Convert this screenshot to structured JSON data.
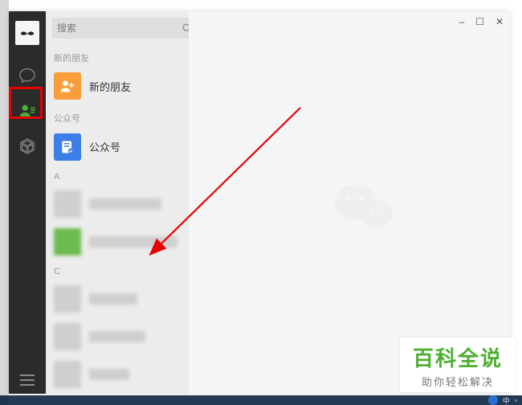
{
  "search": {
    "placeholder": "搜索"
  },
  "sections": {
    "new_friends_header": "新的朋友",
    "new_friends_label": "新的朋友",
    "official_header": "公众号",
    "official_label": "公众号",
    "group_a": "A",
    "group_c": "C"
  },
  "window_controls": {
    "min": "–",
    "max": "☐",
    "close": "✕"
  },
  "watermark": {
    "title": "百科全说",
    "subtitle": "助你轻松解决"
  },
  "tray": {
    "ime": "中",
    "vol": "▫"
  },
  "plus": "+"
}
